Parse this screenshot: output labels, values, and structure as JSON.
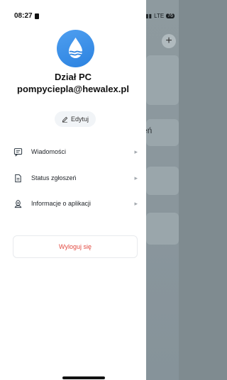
{
  "status_bar": {
    "time": "08:27",
    "network": "LTE",
    "battery": "76"
  },
  "profile": {
    "name": "Dział PC",
    "email": "pompyciepla@hewalex.pl",
    "edit_label": "Edytuj"
  },
  "menu": {
    "items": [
      {
        "label": "Wiadomości",
        "icon": "message-icon"
      },
      {
        "label": "Status zgłoszeń",
        "icon": "document-icon"
      },
      {
        "label": "Informacje o aplikacji",
        "icon": "info-icon"
      }
    ]
  },
  "logout_label": "Wyloguj się",
  "background": {
    "partial_text": "eń",
    "plus": "+"
  },
  "colors": {
    "accent": "#2b82e0",
    "logout": "#e24b42"
  }
}
